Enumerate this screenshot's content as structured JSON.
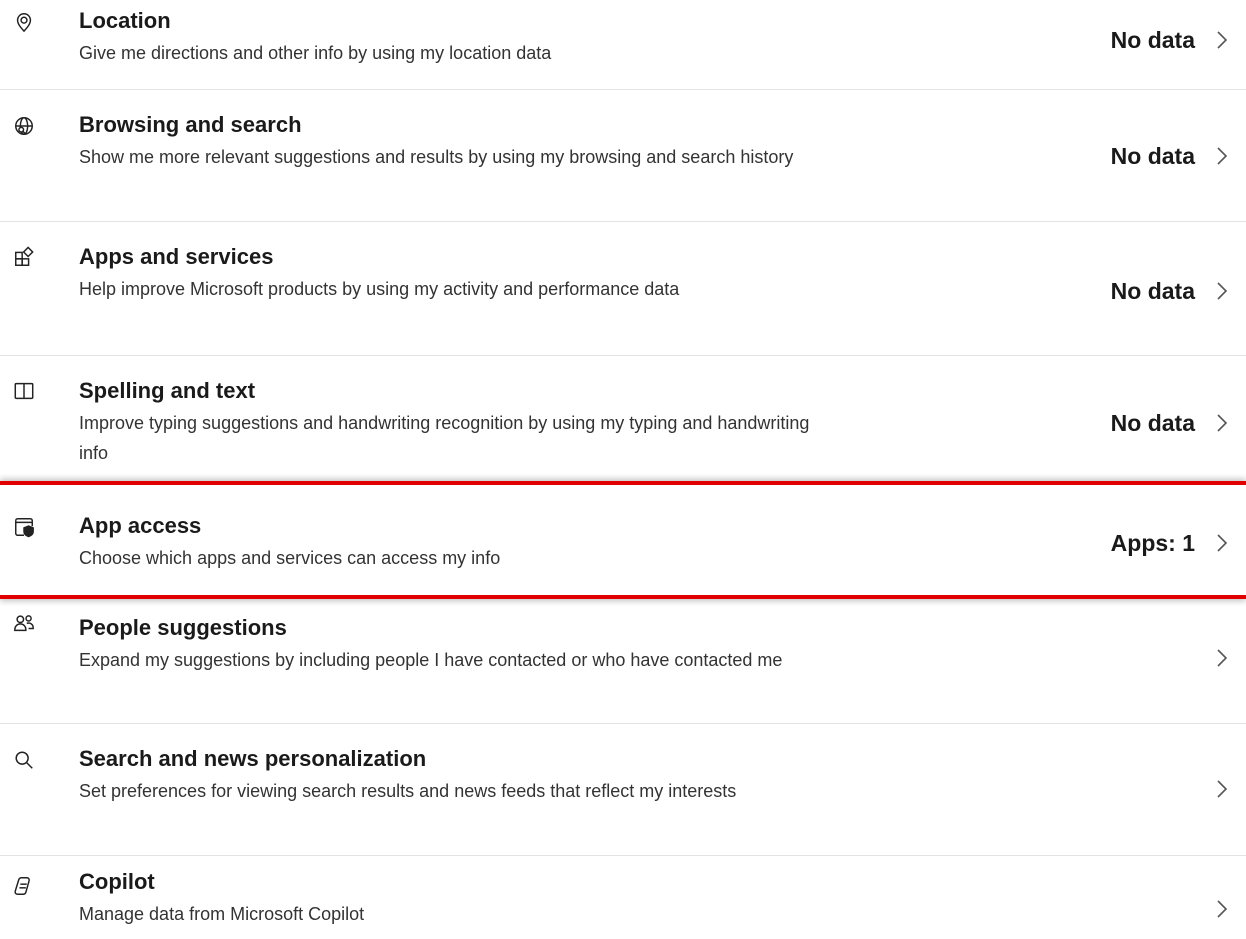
{
  "items": [
    {
      "icon": "location-pin-icon",
      "title": "Location",
      "description": "Give me directions and other info by using my location data",
      "status": "No data"
    },
    {
      "icon": "globe-search-icon",
      "title": "Browsing and search",
      "description": "Show me more relevant suggestions and results by using my browsing and search history",
      "status": "No data"
    },
    {
      "icon": "apps-grid-icon",
      "title": "Apps and services",
      "description": "Help improve Microsoft products by using my activity and performance data",
      "status": "No data"
    },
    {
      "icon": "book-icon",
      "title": "Spelling and text",
      "description": "Improve typing suggestions and handwriting recognition by using my typing and handwriting info",
      "status": "No data"
    },
    {
      "icon": "window-shield-icon",
      "title": "App access",
      "description": "Choose which apps and services can access my info",
      "status": "Apps: 1",
      "highlighted": true,
      "highlight_color": "#e00000"
    },
    {
      "icon": "people-icon",
      "title": "People suggestions",
      "description": "Expand my suggestions by including people I have contacted or who have contacted me",
      "status": ""
    },
    {
      "icon": "search-icon",
      "title": "Search and news personalization",
      "description": "Set preferences for viewing search results and news feeds that reflect my interests",
      "status": ""
    },
    {
      "icon": "copilot-icon",
      "title": "Copilot",
      "description": "Manage data from Microsoft Copilot",
      "status": ""
    }
  ]
}
